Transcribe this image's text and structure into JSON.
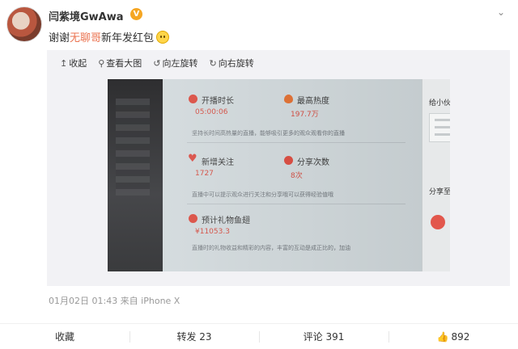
{
  "post": {
    "author": "闫紫境GwAwa",
    "verified_badge": "V",
    "text_before": "谢谢",
    "mention": "无聊哥",
    "text_after": "新年发红包",
    "emoji": "laughing-emoji",
    "meta": "01月02日 01:43 来自 iPhone X"
  },
  "media_toolbar": {
    "collapse": "收起",
    "view_large": "查看大图",
    "rotate_left": "向左旋转",
    "rotate_right": "向右旋转"
  },
  "photo": {
    "metrics": [
      {
        "label": "开播时长",
        "value": "05:00:06",
        "icon": "play-icon"
      },
      {
        "label": "最高热度",
        "value": "197.7万",
        "icon": "flame-icon"
      },
      {
        "label": "新增关注",
        "value": "1727",
        "icon": "heart-icon"
      },
      {
        "label": "分享次数",
        "value": "8次",
        "icon": "share-icon"
      },
      {
        "label": "预计礼物鱼翅",
        "value": "¥11053.3",
        "icon": "gift-icon"
      }
    ],
    "desc1": "坚持长时间高热量的直播，能够吸引更多的观众观看你的直播",
    "desc2": "直播中可以提示观众进行关注和分享哦可以获得经验值哦",
    "desc3": "直播时的礼物收益和精彩的内容，丰富的互动是成正比的，加油",
    "right_title": "给小伙伴看下你的直播成",
    "right_share": "分享至："
  },
  "actions": {
    "favorite": "收藏",
    "repost": "转发 23",
    "comment": "评论 391",
    "like": "892"
  },
  "colors": {
    "mention": "#eb7350",
    "accent_red": "#d2463a",
    "badge": "#f5a623"
  }
}
